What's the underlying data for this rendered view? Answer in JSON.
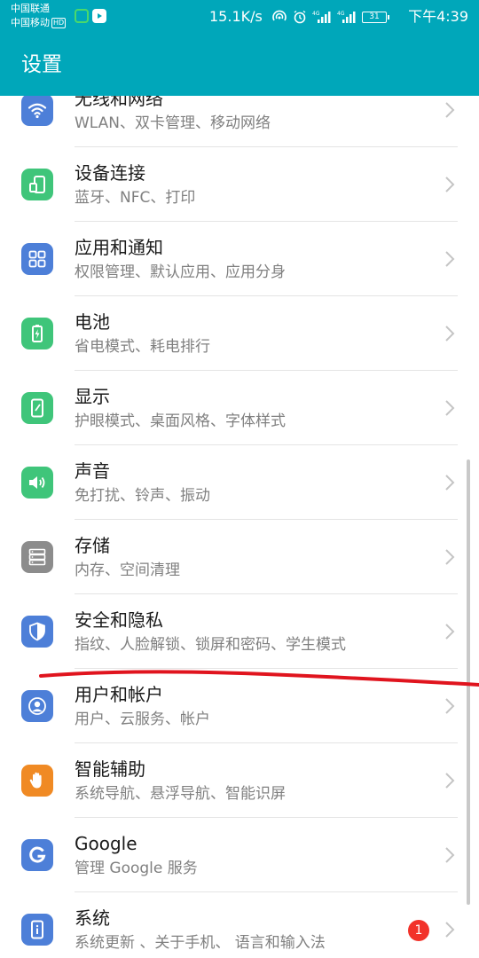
{
  "status_bar": {
    "carrier_1": "中国联通",
    "carrier_2": "中国移动",
    "hd": "HD",
    "net_speed": "15.1K/s",
    "battery": "31",
    "time": "下午4:39",
    "app_icon_colors": [
      "#4bd96a",
      "#ffffff"
    ]
  },
  "app_bar": {
    "title": "设置"
  },
  "settings_items": [
    {
      "title": "无线和网络",
      "subtitle": "WLAN、双卡管理、移动网络",
      "icon": "wifi-icon",
      "color": "#4d7fd8"
    },
    {
      "title": "设备连接",
      "subtitle": "蓝牙、NFC、打印",
      "icon": "device-connect-icon",
      "color": "#3fc57a"
    },
    {
      "title": "应用和通知",
      "subtitle": "权限管理、默认应用、应用分身",
      "icon": "apps-grid-icon",
      "color": "#4d7fd8"
    },
    {
      "title": "电池",
      "subtitle": "省电模式、耗电排行",
      "icon": "battery-icon",
      "color": "#3fc57a"
    },
    {
      "title": "显示",
      "subtitle": "护眼模式、桌面风格、字体样式",
      "icon": "display-icon",
      "color": "#3fc57a"
    },
    {
      "title": "声音",
      "subtitle": "免打扰、铃声、振动",
      "icon": "speaker-icon",
      "color": "#3fc57a"
    },
    {
      "title": "存储",
      "subtitle": "内存、空间清理",
      "icon": "storage-icon",
      "color": "#8c8c8c"
    },
    {
      "title": "安全和隐私",
      "subtitle": "指纹、人脸解锁、锁屏和密码、学生模式",
      "icon": "shield-icon",
      "color": "#4d7fd8"
    },
    {
      "title": "用户和帐户",
      "subtitle": "用户、云服务、帐户",
      "icon": "user-account-icon",
      "color": "#4d7fd8"
    },
    {
      "title": "智能辅助",
      "subtitle": "系统导航、悬浮导航、智能识屏",
      "icon": "hand-icon",
      "color": "#f08a24"
    },
    {
      "title": "Google",
      "subtitle": "管理 Google 服务",
      "icon": "google-icon",
      "color": "#4d7fd8"
    },
    {
      "title": "系统",
      "subtitle": "系统更新 、关于手机、 语言和输入法",
      "icon": "system-info-icon",
      "color": "#4d7fd8",
      "badge": "1"
    }
  ],
  "annotation_color": "#e0141e"
}
